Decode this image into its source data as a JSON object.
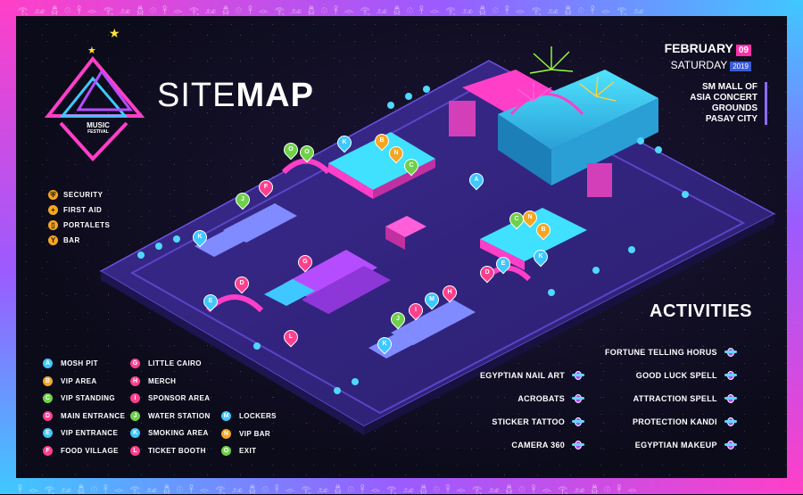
{
  "header": {
    "title_thin": "SITE",
    "title_bold": "MAP",
    "logo_text": "MUSIC",
    "logo_subtext": "FESTIVAL"
  },
  "date": {
    "month": "FEBRUARY",
    "day": "09",
    "weekday": "SATURDAY",
    "year": "2019"
  },
  "venue": {
    "line1": "SM MALL OF",
    "line2": "ASIA CONCERT",
    "line3": "GROUNDS",
    "line4": "PASAY CITY"
  },
  "facilities": [
    {
      "icon": "shield-icon",
      "label": "SECURITY"
    },
    {
      "icon": "plus-icon",
      "label": "FIRST AID"
    },
    {
      "icon": "toilet-icon",
      "label": "PORTALETS"
    },
    {
      "icon": "cocktail-icon",
      "label": "BAR"
    }
  ],
  "legend": [
    {
      "code": "A",
      "label": "MOSH PIT",
      "color": "#3fc8ff"
    },
    {
      "code": "B",
      "label": "VIP AREA",
      "color": "#f6a623"
    },
    {
      "code": "C",
      "label": "VIP STANDING",
      "color": "#6fd14a"
    },
    {
      "code": "D",
      "label": "MAIN ENTRANCE",
      "color": "#ff3f8e"
    },
    {
      "code": "E",
      "label": "VIP ENTRANCE",
      "color": "#3fc8ff"
    },
    {
      "code": "F",
      "label": "FOOD VILLAGE",
      "color": "#ff3f8e"
    },
    {
      "code": "G",
      "label": "LITTLE CAIRO",
      "color": "#ff3f8e"
    },
    {
      "code": "H",
      "label": "MERCH",
      "color": "#ff3f8e"
    },
    {
      "code": "I",
      "label": "SPONSOR AREA",
      "color": "#ff3f8e"
    },
    {
      "code": "J",
      "label": "WATER STATION",
      "color": "#6fd14a"
    },
    {
      "code": "K",
      "label": "SMOKING AREA",
      "color": "#3fc8ff"
    },
    {
      "code": "L",
      "label": "TICKET BOOTH",
      "color": "#ff3f8e"
    },
    {
      "code": "M",
      "label": "LOCKERS",
      "color": "#3fc8ff"
    },
    {
      "code": "N",
      "label": "VIP BAR",
      "color": "#f6a623"
    },
    {
      "code": "O",
      "label": "EXIT",
      "color": "#6fd14a"
    }
  ],
  "activities": {
    "title": "ACTIVITIES",
    "left": [
      "EGYPTIAN NAIL ART",
      "ACROBATS",
      "STICKER TATTOO",
      "CAMERA 360"
    ],
    "right": [
      "FORTUNE TELLING HORUS",
      "GOOD LUCK SPELL",
      "ATTRACTION SPELL",
      "PROTECTION KANDI",
      "EGYPTIAN MAKEUP"
    ]
  },
  "map_pins": [
    {
      "code": "A",
      "color": "#3fc8ff"
    },
    {
      "code": "B",
      "color": "#f6a623"
    },
    {
      "code": "B",
      "color": "#f6a623"
    },
    {
      "code": "C",
      "color": "#6fd14a"
    },
    {
      "code": "C",
      "color": "#6fd14a"
    },
    {
      "code": "D",
      "color": "#ff3f8e"
    },
    {
      "code": "D",
      "color": "#ff3f8e"
    },
    {
      "code": "E",
      "color": "#3fc8ff"
    },
    {
      "code": "E",
      "color": "#3fc8ff"
    },
    {
      "code": "F",
      "color": "#ff3f8e"
    },
    {
      "code": "G",
      "color": "#ff3f8e"
    },
    {
      "code": "H",
      "color": "#ff3f8e"
    },
    {
      "code": "I",
      "color": "#ff3f8e"
    },
    {
      "code": "J",
      "color": "#6fd14a"
    },
    {
      "code": "J",
      "color": "#6fd14a"
    },
    {
      "code": "K",
      "color": "#3fc8ff"
    },
    {
      "code": "K",
      "color": "#3fc8ff"
    },
    {
      "code": "K",
      "color": "#3fc8ff"
    },
    {
      "code": "K",
      "color": "#3fc8ff"
    },
    {
      "code": "L",
      "color": "#ff3f8e"
    },
    {
      "code": "M",
      "color": "#3fc8ff"
    },
    {
      "code": "N",
      "color": "#f6a623"
    },
    {
      "code": "N",
      "color": "#f6a623"
    },
    {
      "code": "O",
      "color": "#6fd14a"
    },
    {
      "code": "O",
      "color": "#6fd14a"
    }
  ]
}
